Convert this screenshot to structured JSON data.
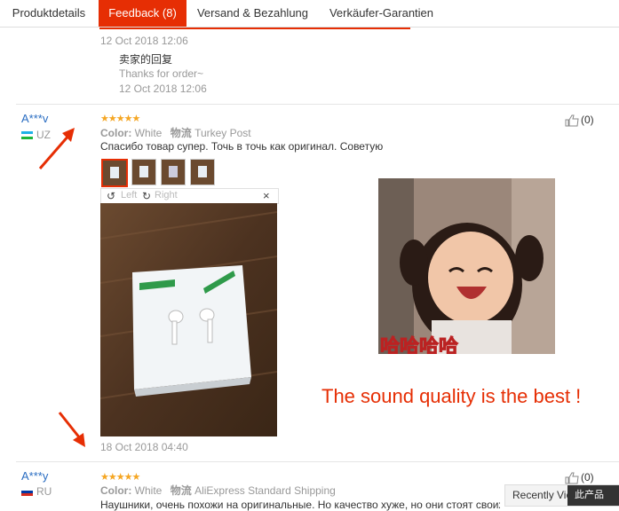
{
  "tabs": [
    {
      "label": "Produktdetails"
    },
    {
      "label": "Feedback (8)"
    },
    {
      "label": "Versand & Bezahlung"
    },
    {
      "label": "Verkäufer-Garantien"
    }
  ],
  "prev_review": {
    "date": "12 Oct 2018 12:06",
    "seller_reply_title": "卖家的回复",
    "seller_reply_text": "Thanks for order~",
    "seller_reply_date": "12 Oct 2018 12:06"
  },
  "review1": {
    "user": "A***v",
    "country": "UZ",
    "stars": "★★★★★",
    "color_label": "Color:",
    "color_value": "White",
    "logistics_label": "物流",
    "logistics_value": "Turkey Post",
    "text": "Спасибо товар супер. Точь в точь как оригинал. Советую",
    "likes": "(0)",
    "toolbar_left": "Left",
    "toolbar_right": "Right",
    "toolbar_close": "×",
    "date": "18 Oct 2018 04:40",
    "meme_caption": "哈哈哈哈",
    "overlay_text": "The sound quality is the best !"
  },
  "review2": {
    "user": "A***y",
    "country": "RU",
    "stars": "★★★★★",
    "color_label": "Color:",
    "color_value": "White",
    "logistics_label": "物流",
    "logistics_value": "AliExpress Standard Shipping",
    "text": "Наушники, очень похожи на оригинальные. Но качество хуже, но они стоят своих денег",
    "likes": "(0)"
  },
  "recently_viewed": {
    "label": "Recently Viewed",
    "badge": "此产品"
  },
  "colors": {
    "accent": "#e62e04",
    "user": "#2a6dc2",
    "star": "#f5a623",
    "annotation": "#e62e04"
  }
}
